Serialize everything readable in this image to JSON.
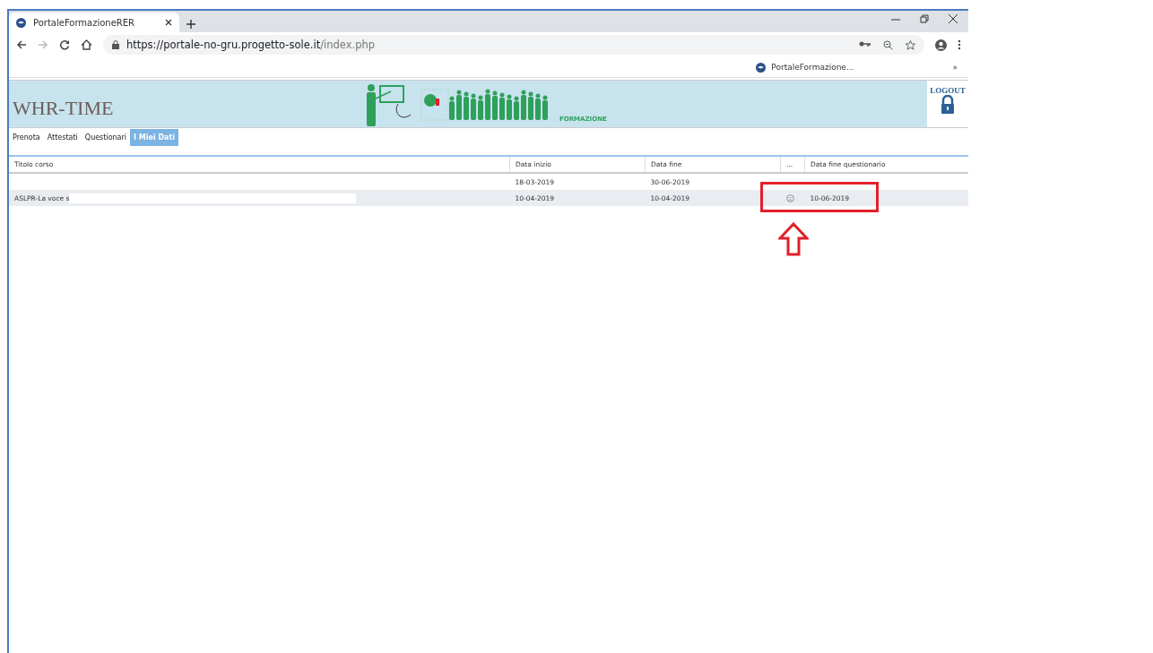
{
  "browser": {
    "tab_title": "PortaleFormazioneRER",
    "url_host": "https://portale-no-gru.progetto-sole.it",
    "url_path": "/index.php",
    "bookmark": "PortaleFormazione...",
    "bookmarks_more": "»"
  },
  "banner": {
    "logo": "WHR-TIME",
    "caption": "FORMAZIONE",
    "logout": "LOGOUT"
  },
  "nav": [
    {
      "label": "Prenota",
      "selected": false
    },
    {
      "label": "Attestati",
      "selected": false
    },
    {
      "label": "Questionari",
      "selected": false
    },
    {
      "label": "I Miei Dati",
      "selected": true
    }
  ],
  "table": {
    "columns": [
      "Titolo corso",
      "Data inizio",
      "Data fine",
      "...",
      "Data fine questionario"
    ],
    "rows": [
      {
        "title": "",
        "start": "18-03-2019",
        "end": "30-06-2019",
        "icon": false,
        "survey_end": ""
      },
      {
        "title": "ASLPR-La voce s",
        "start": "10-04-2019",
        "end": "10-04-2019",
        "icon": true,
        "survey_end": "10-06-2019"
      }
    ]
  }
}
